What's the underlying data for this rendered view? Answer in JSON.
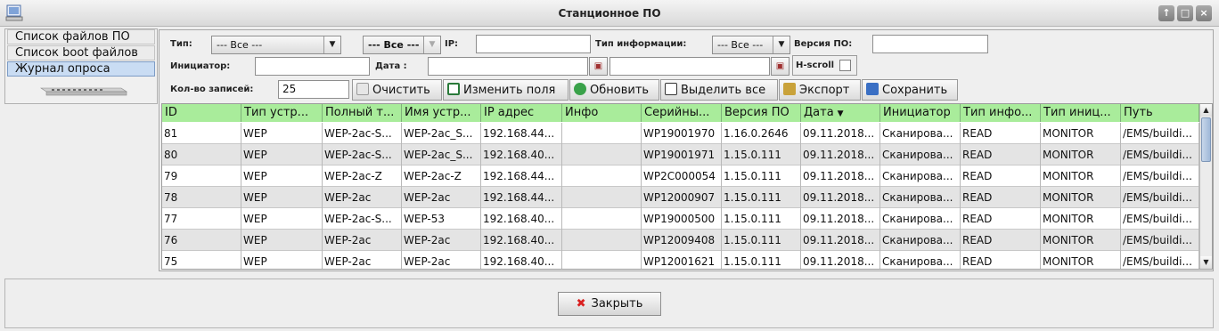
{
  "window": {
    "title": "Станционное ПО",
    "controls": [
      "↑",
      "□",
      "×"
    ]
  },
  "nav": {
    "items": [
      "Список файлов ПО",
      "Список boot файлов",
      "Журнал опроса"
    ],
    "selected_index": 2
  },
  "filters": {
    "type_label": "Тип:",
    "type_value": "--- Все ---",
    "second_value": "--- Все ---",
    "ip_label": "IP:",
    "ip_value": "",
    "info_type_label": "Тип информации:",
    "info_type_value": "--- Все ---",
    "version_label": "Версия ПО:",
    "version_value": "",
    "initiator_label": "Инициатор:",
    "initiator_value": "",
    "date_label": "Дата :",
    "date_from": "",
    "date_to": "",
    "hscroll_label": "H-scroll",
    "count_label": "Кол-во записей:",
    "count_value": "25"
  },
  "toolbar": {
    "clear": "Очистить",
    "edit_fields": "Изменить поля",
    "refresh": "Обновить",
    "select_all": "Выделить все",
    "export": "Экспорт",
    "save": "Сохранить"
  },
  "table": {
    "columns": [
      "ID",
      "Тип устр...",
      "Полный т...",
      "Имя устр...",
      "IP адрес",
      "Инфо",
      "Серийны...",
      "Версия ПО",
      "Дата",
      "Инициатор",
      "Тип инфо...",
      "Тип иниц...",
      "Путь"
    ],
    "sort_indicator": "▼",
    "rows": [
      [
        "81",
        "WEP",
        "WEP-2ac-S...",
        "WEP-2ac_S...",
        "192.168.44...",
        "",
        "WP19001970",
        "1.16.0.2646",
        "09.11.2018...",
        "Сканирова...",
        "READ",
        "MONITOR",
        "/EMS/buildi..."
      ],
      [
        "80",
        "WEP",
        "WEP-2ac-S...",
        "WEP-2ac_S...",
        "192.168.40...",
        "",
        "WP19001971",
        "1.15.0.111",
        "09.11.2018...",
        "Сканирова...",
        "READ",
        "MONITOR",
        "/EMS/buildi..."
      ],
      [
        "79",
        "WEP",
        "WEP-2ac-Z",
        "WEP-2ac-Z",
        "192.168.44...",
        "",
        "WP2C000054",
        "1.15.0.111",
        "09.11.2018...",
        "Сканирова...",
        "READ",
        "MONITOR",
        "/EMS/buildi..."
      ],
      [
        "78",
        "WEP",
        "WEP-2ac",
        "WEP-2ac",
        "192.168.44...",
        "",
        "WP12000907",
        "1.15.0.111",
        "09.11.2018...",
        "Сканирова...",
        "READ",
        "MONITOR",
        "/EMS/buildi..."
      ],
      [
        "77",
        "WEP",
        "WEP-2ac-S...",
        "WEP-53",
        "192.168.40...",
        "",
        "WP19000500",
        "1.15.0.111",
        "09.11.2018...",
        "Сканирова...",
        "READ",
        "MONITOR",
        "/EMS/buildi..."
      ],
      [
        "76",
        "WEP",
        "WEP-2ac",
        "WEP-2ac",
        "192.168.40...",
        "",
        "WP12009408",
        "1.15.0.111",
        "09.11.2018...",
        "Сканирова...",
        "READ",
        "MONITOR",
        "/EMS/buildi..."
      ],
      [
        "75",
        "WEP",
        "WEP-2ac",
        "WEP-2ac",
        "192.168.40...",
        "",
        "WP12001621",
        "1.15.0.111",
        "09.11.2018...",
        "Сканирова...",
        "READ",
        "MONITOR",
        "/EMS/buildi..."
      ]
    ]
  },
  "footer": {
    "close": "Закрыть"
  },
  "colors": {
    "header_bg": "#a9ec9b",
    "alt_row_bg": "#e4e4e4",
    "selected_tab_bg": "#c9dcf3",
    "close_icon": "#d92020"
  }
}
